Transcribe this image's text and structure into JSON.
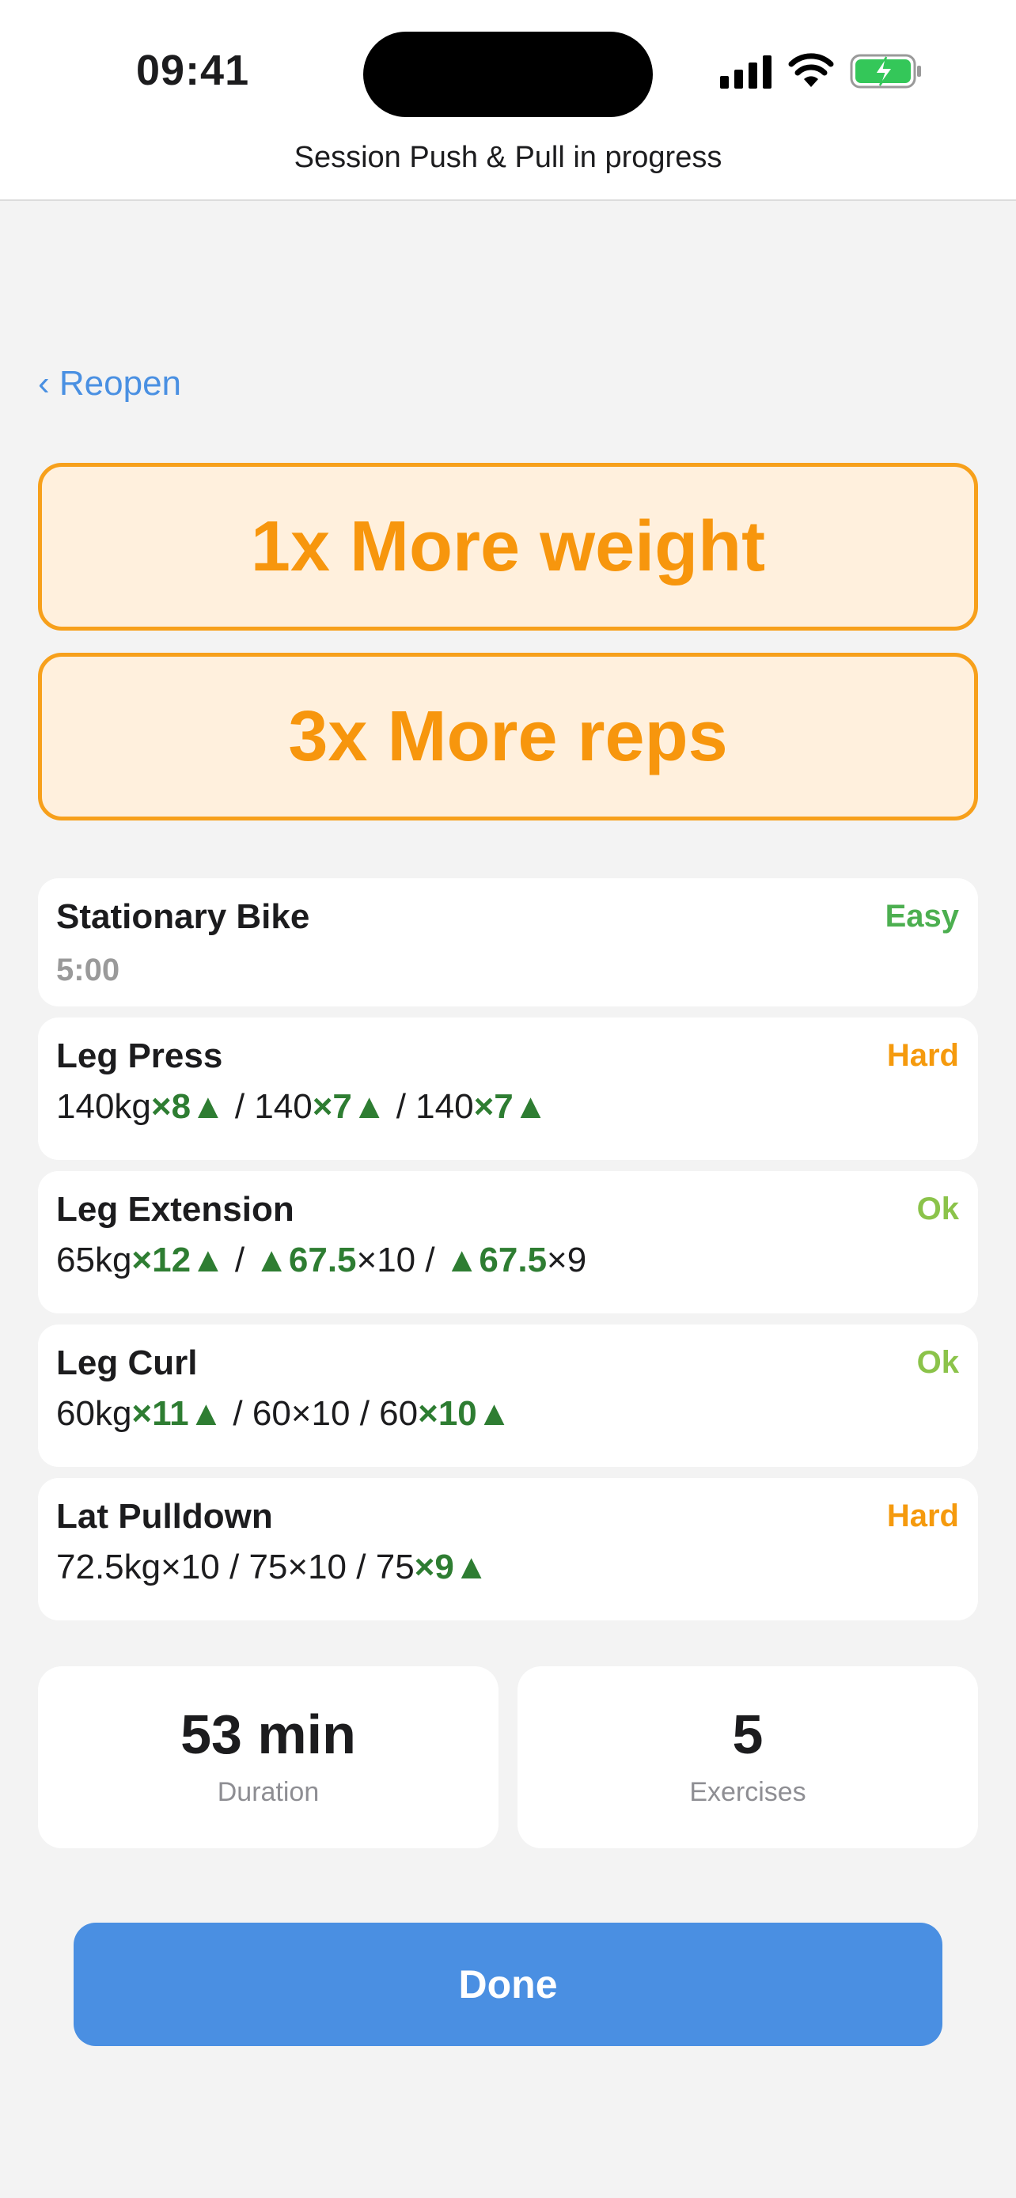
{
  "status": {
    "time": "09:41"
  },
  "header": {
    "title": "Session Push & Pull in progress"
  },
  "nav": {
    "back_label": "‹ Reopen"
  },
  "banners": [
    {
      "text": "1x More weight"
    },
    {
      "text": "3x More reps"
    }
  ],
  "exercises": [
    {
      "name": "Stationary Bike",
      "difficulty": "Easy",
      "difficulty_color": "#4caf50",
      "sets": [
        {
          "text": "5:00"
        }
      ]
    },
    {
      "name": "Leg Press",
      "difficulty": "Hard",
      "difficulty_color": "#f59a0d",
      "sets": [
        {
          "weight": "140kg",
          "reps": "×8",
          "up": "reps"
        },
        {
          "weight": "140",
          "reps": "×7",
          "up": "reps"
        },
        {
          "weight": "140",
          "reps": "×7",
          "up": "reps"
        }
      ]
    },
    {
      "name": "Leg Extension",
      "difficulty": "Ok",
      "difficulty_color": "#8bc34a",
      "sets": [
        {
          "weight": "65kg",
          "reps": "×12",
          "up": "reps"
        },
        {
          "weight": "67.5",
          "reps": "×10",
          "up": "weight"
        },
        {
          "weight": "67.5",
          "reps": "×9",
          "up": "weight"
        }
      ]
    },
    {
      "name": "Leg Curl",
      "difficulty": "Ok",
      "difficulty_color": "#8bc34a",
      "sets": [
        {
          "weight": "60kg",
          "reps": "×11",
          "up": "reps"
        },
        {
          "weight": "60",
          "reps": "×10",
          "up": "none"
        },
        {
          "weight": "60",
          "reps": "×10",
          "up": "reps"
        }
      ]
    },
    {
      "name": "Lat Pulldown",
      "difficulty": "Hard",
      "difficulty_color": "#f59a0d",
      "sets": [
        {
          "weight": "72.5kg",
          "reps": "×10",
          "up": "none"
        },
        {
          "weight": "75",
          "reps": "×10",
          "up": "none"
        },
        {
          "weight": "75",
          "reps": "×9",
          "up": "reps"
        }
      ]
    }
  ],
  "stats": [
    {
      "value": "53 min",
      "label": "Duration"
    },
    {
      "value": "5",
      "label": "Exercises"
    }
  ],
  "actions": {
    "done_label": "Done"
  },
  "icons": {
    "increase": "up-triangle-icon",
    "signal": "signal-icon",
    "wifi": "wifi-icon",
    "battery": "battery-charging-icon"
  },
  "colors": {
    "accent": "#4a90e2",
    "warning": "#f7960d",
    "increase": "#2e7d32"
  }
}
